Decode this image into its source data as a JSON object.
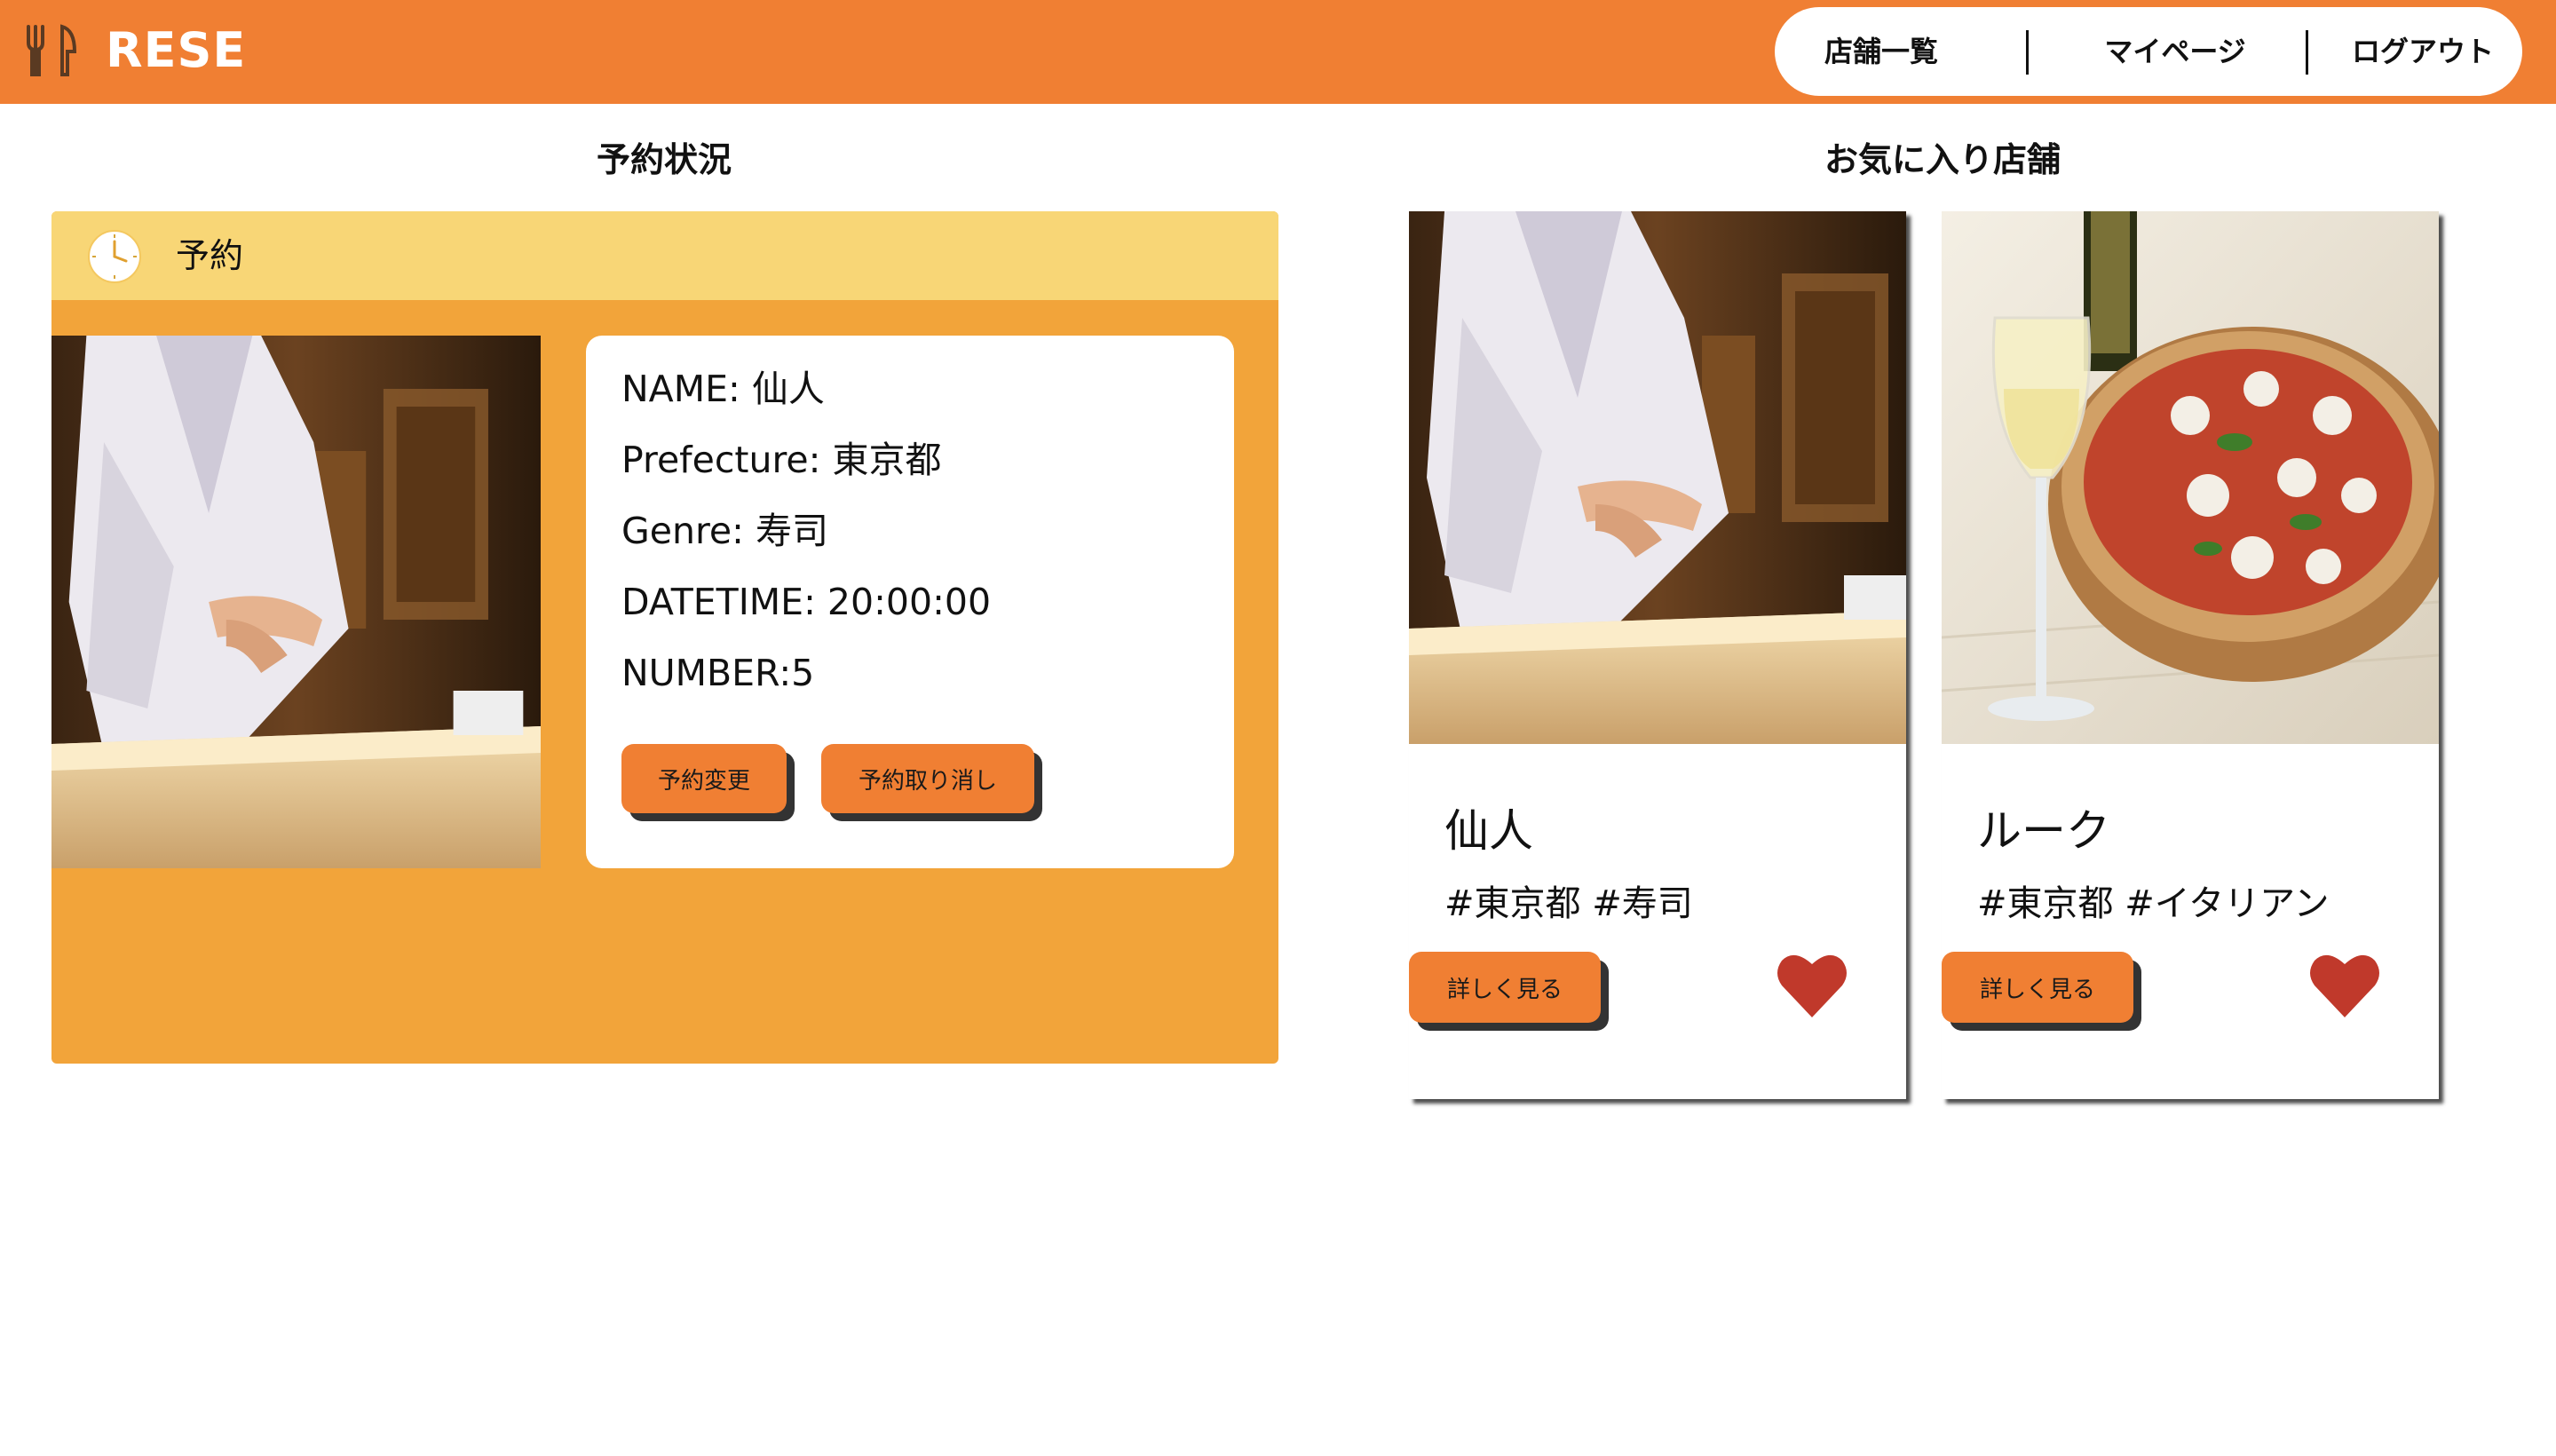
{
  "header": {
    "logo_text": "RESE",
    "logo_icon": "fork-knife-icon",
    "background": "#f07f33",
    "nav": [
      {
        "label": "店舗一覧"
      },
      {
        "label": "マイページ"
      },
      {
        "label": "ログアウト"
      }
    ]
  },
  "reservations": {
    "title": "予約状況",
    "card": {
      "header_label": "予約",
      "header_icon": "clock-icon",
      "photo": "sushi-chef-photo",
      "name": "NAME: 仙人",
      "prefecture": "Prefecture: 東京都",
      "genre": "Genre: 寿司",
      "datetime": "DATETIME: 20:00:00",
      "number": "NUMBER:5",
      "change_button": "予約変更",
      "cancel_button": "予約取り消し"
    },
    "panel_color": "#f2a43a",
    "bar_color": "#f8d676"
  },
  "favorites": {
    "title": "お気に入り店舗",
    "shops": [
      {
        "name": "仙人",
        "tags": "#東京都 #寿司",
        "photo": "sushi-chef-photo",
        "detail_button": "詳しく見る",
        "favorite": true
      },
      {
        "name": "ルーク",
        "tags": "#東京都 #イタリアン",
        "photo": "pizza-wine-photo",
        "detail_button": "詳しく見る",
        "favorite": true
      }
    ],
    "heart_color": "#c0392b"
  }
}
